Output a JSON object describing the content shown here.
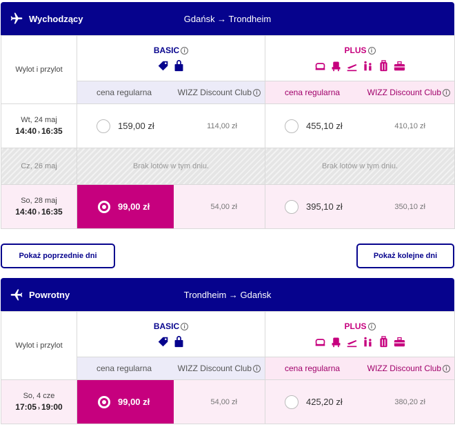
{
  "outbound": {
    "label": "Wychodzący",
    "route": "Gdańsk → Trondheim",
    "col_label": "Wylot i przylot",
    "basic": {
      "name": "BASIC",
      "regular": "cena regularna",
      "club": "WIZZ Discount Club"
    },
    "plus": {
      "name": "PLUS",
      "regular": "cena regularna",
      "club": "WIZZ Discount Club"
    },
    "rows": [
      {
        "date": "Wt, 24 maj",
        "dep": "14:40",
        "arr": "16:35",
        "basic_price": "159,00 zł",
        "basic_disc": "114,00 zł",
        "plus_price": "455,10 zł",
        "plus_disc": "410,10 zł"
      },
      {
        "date": "Cz, 26 maj",
        "no_flights": "Brak lotów w tym dniu."
      },
      {
        "date": "So, 28 maj",
        "dep": "14:40",
        "arr": "16:35",
        "basic_price": "99,00 zł",
        "basic_disc": "54,00 zł",
        "plus_price": "395,10 zł",
        "plus_disc": "350,10 zł"
      }
    ]
  },
  "nav": {
    "prev": "Pokaż poprzednie dni",
    "next": "Pokaż kolejne dni"
  },
  "return": {
    "label": "Powrotny",
    "route": "Trondheim → Gdańsk",
    "col_label": "Wylot i przylot",
    "basic": {
      "name": "BASIC",
      "regular": "cena regularna",
      "club": "WIZZ Discount Club"
    },
    "plus": {
      "name": "PLUS",
      "regular": "cena regularna",
      "club": "WIZZ Discount Club"
    },
    "rows": [
      {
        "date": "So, 4 cze",
        "dep": "17:05",
        "arr": "19:00",
        "basic_price": "99,00 zł",
        "basic_disc": "54,00 zł",
        "plus_price": "425,20 zł",
        "plus_disc": "380,20 zł"
      }
    ]
  },
  "icons": {
    "basic": [
      "tag-icon",
      "bag-icon"
    ],
    "plus": [
      "seat-icon",
      "priority-seat-icon",
      "plane-depart-icon",
      "family-icon",
      "luggage-icon",
      "suitcase-icon"
    ]
  },
  "colors": {
    "brand_navy": "#06038d",
    "brand_magenta": "#c6007e"
  }
}
